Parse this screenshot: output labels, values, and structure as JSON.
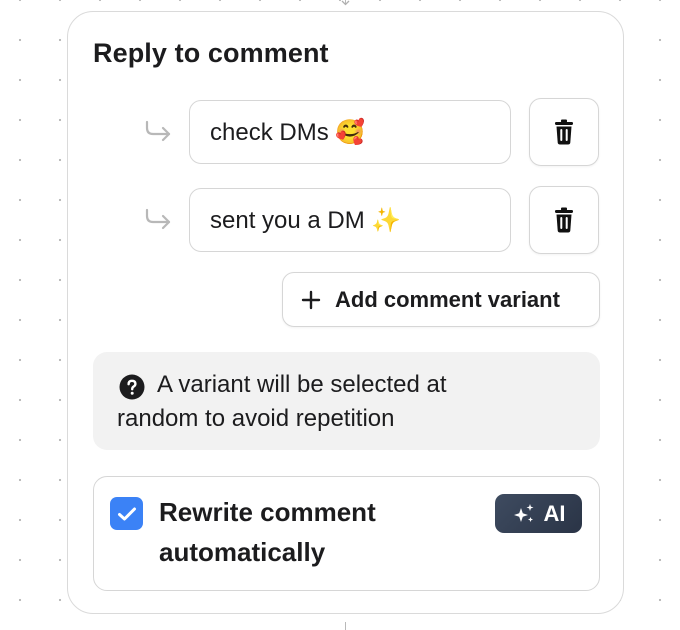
{
  "title": "Reply to comment",
  "replies": [
    {
      "text": "check DMs 🥰"
    },
    {
      "text": "sent you a DM ✨"
    }
  ],
  "add_button": {
    "label": "Add comment variant"
  },
  "info": {
    "line1": "A variant will be selected at",
    "line2": "random to avoid repetition"
  },
  "rewrite": {
    "checked": true,
    "line1": "Rewrite comment",
    "line2": "automatically",
    "badge": "AI"
  },
  "colors": {
    "accent": "#3b82f6",
    "badge_bg": "#2f3a4d",
    "info_bg": "#f2f2f2",
    "border": "#d6d6d6"
  },
  "icons": {
    "reply_arrow": "reply-arrow-icon",
    "delete": "trash-icon",
    "add": "plus-icon",
    "info": "question-circle-icon",
    "checkbox": "check-icon",
    "ai": "sparkles-icon"
  }
}
